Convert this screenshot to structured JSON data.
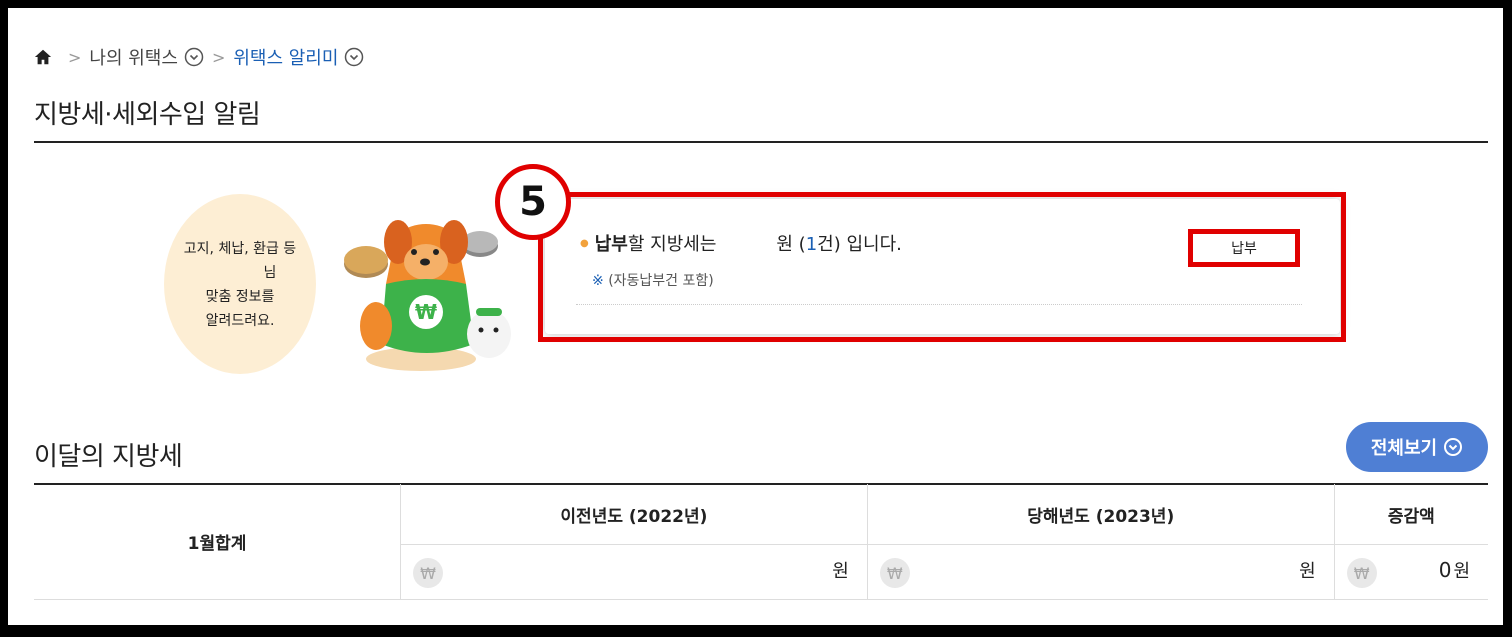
{
  "breadcrumb": {
    "level1": "나의 위택스",
    "level2": "위택스 알리미"
  },
  "page": {
    "title": "지방세·세외수입 알림"
  },
  "notice": {
    "bubble_line1": "고지, 체납, 환급 등",
    "bubble_line2": "님",
    "bubble_line3": "맞춤 정보를",
    "bubble_line4": "알려드려요.",
    "step_number": "5",
    "pay_strong": "납부",
    "pay_text": "할 지방세는",
    "amount_unit": "원 (",
    "count": "1",
    "count_suffix": "건) 입니다.",
    "note_mark": "※",
    "note_text": "(자동납부건 포함)",
    "pay_button": "납부"
  },
  "monthly": {
    "title": "이달의 지방세",
    "view_all": "전체보기",
    "row_label": "1월합계",
    "headers": [
      "이전년도 (2022년)",
      "당해년도 (2023년)",
      "증감액"
    ],
    "won_symbol": "₩",
    "values": [
      "",
      "",
      "0"
    ],
    "unit": "원"
  },
  "colors": {
    "accent": "#1a5fb4",
    "button": "#4f7fd4",
    "highlight": "#e00000"
  },
  "icons": [
    "home-icon",
    "chevron-circle-icon",
    "won-icon",
    "mascot-image"
  ]
}
